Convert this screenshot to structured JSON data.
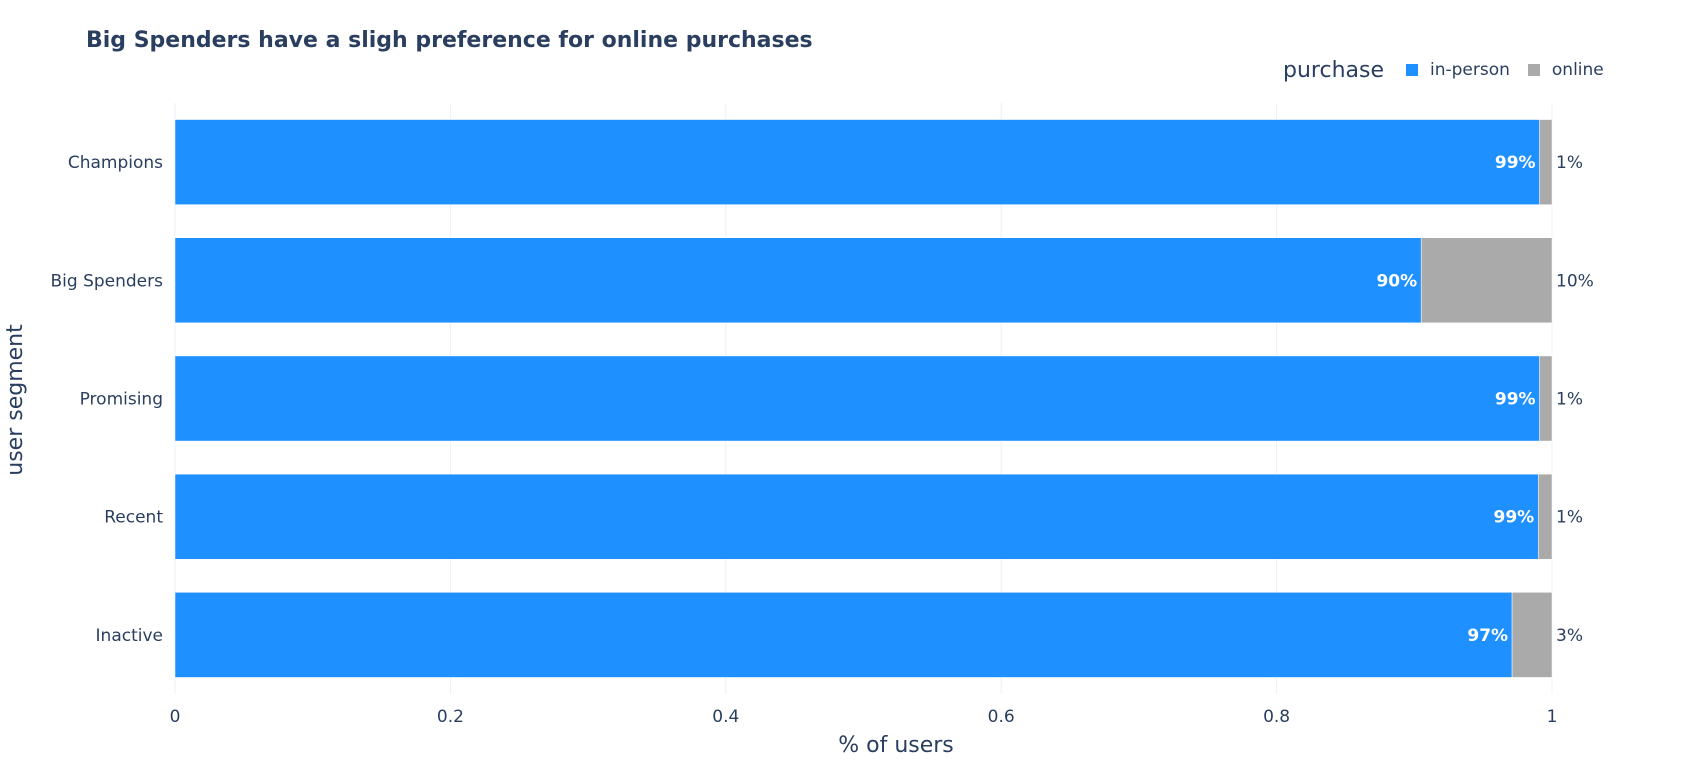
{
  "chart_data": {
    "type": "bar",
    "orientation": "horizontal",
    "barmode": "stack",
    "title": "Big Spenders have a sligh preference for online purchases",
    "xlabel": "% of users",
    "ylabel": "user segment",
    "xlim": [
      0,
      1
    ],
    "xticks": [
      "0",
      "0.2",
      "0.4",
      "0.6",
      "0.8",
      "1"
    ],
    "grid": true,
    "legend": {
      "title": "purchase",
      "placement": "top-right"
    },
    "categories": [
      "Champions",
      "Big Spenders",
      "Promising",
      "Recent",
      "Inactive"
    ],
    "series": [
      {
        "name": "in-person",
        "color": "#1e90ff",
        "values": [
          0.991,
          0.905,
          0.991,
          0.99,
          0.971
        ],
        "labels": [
          "99%",
          "90%",
          "99%",
          "99%",
          "97%"
        ]
      },
      {
        "name": "online",
        "color": "#aaaaaa",
        "values": [
          0.009,
          0.095,
          0.009,
          0.01,
          0.029
        ],
        "labels": [
          "1%",
          "10%",
          "1%",
          "1%",
          "3%"
        ]
      }
    ]
  }
}
